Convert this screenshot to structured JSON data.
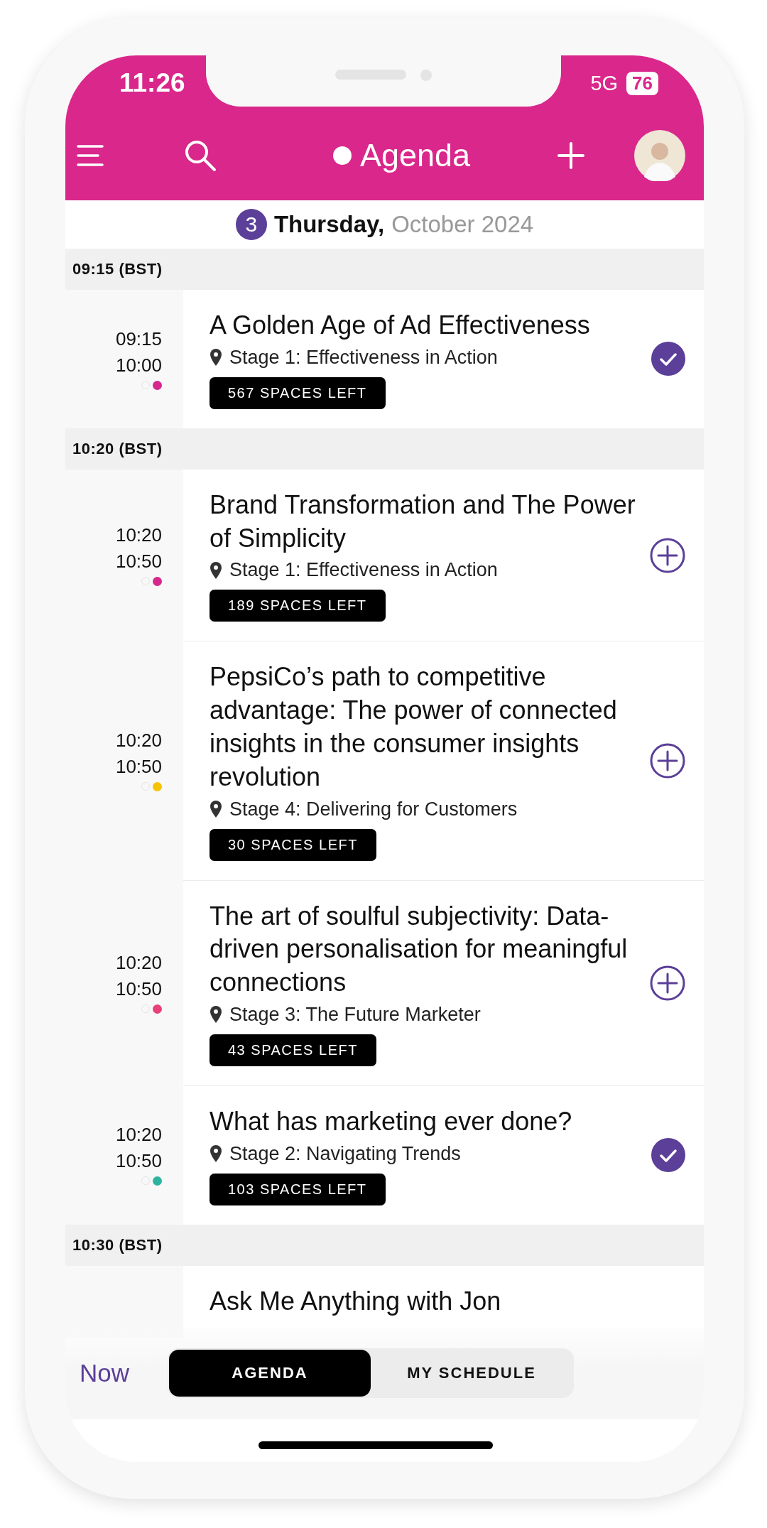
{
  "status_bar": {
    "time": "11:26",
    "network": "5G",
    "battery": "76"
  },
  "nav": {
    "title": "Agenda"
  },
  "date": {
    "day": "3",
    "weekday": "Thursday,",
    "month_year": "October 2024"
  },
  "groups": [
    {
      "label": "09:15 (BST)",
      "sessions": [
        {
          "start": "09:15",
          "end": "10:00",
          "title": "A Golden Age of Ad Effectiveness",
          "location": "Stage 1: Effectiveness in Action",
          "spaces": "567 SPACES LEFT",
          "added": true,
          "color": "#d6278f"
        }
      ]
    },
    {
      "label": "10:20 (BST)",
      "sessions": [
        {
          "start": "10:20",
          "end": "10:50",
          "title": "Brand Transformation and The Power of Simplicity",
          "location": "Stage 1: Effectiveness in Action",
          "spaces": "189 SPACES LEFT",
          "added": false,
          "color": "#d6278f"
        },
        {
          "start": "10:20",
          "end": "10:50",
          "title": "PepsiCo’s path to competitive advantage: The power of connected insights in the consumer insights revolution",
          "location": "Stage 4: Delivering for Customers",
          "spaces": "30 SPACES LEFT",
          "added": false,
          "color": "#f5c400"
        },
        {
          "start": "10:20",
          "end": "10:50",
          "title": "The art of soulful subjectivity: Data-driven personalisation for meaningful connections",
          "location": "Stage 3: The Future Marketer",
          "spaces": "43 SPACES LEFT",
          "added": false,
          "color": "#e8407a"
        },
        {
          "start": "10:20",
          "end": "10:50",
          "title": "What has marketing ever done?",
          "location": "Stage 2: Navigating Trends",
          "spaces": "103 SPACES LEFT",
          "added": true,
          "color": "#2bb59f"
        }
      ]
    },
    {
      "label": "10:30 (BST)",
      "sessions": [
        {
          "title": "Ask Me Anything with Jon"
        }
      ]
    }
  ],
  "bottom": {
    "now": "Now",
    "tabs": [
      {
        "label": "AGENDA",
        "selected": true
      },
      {
        "label": "MY SCHEDULE",
        "selected": false
      }
    ]
  }
}
